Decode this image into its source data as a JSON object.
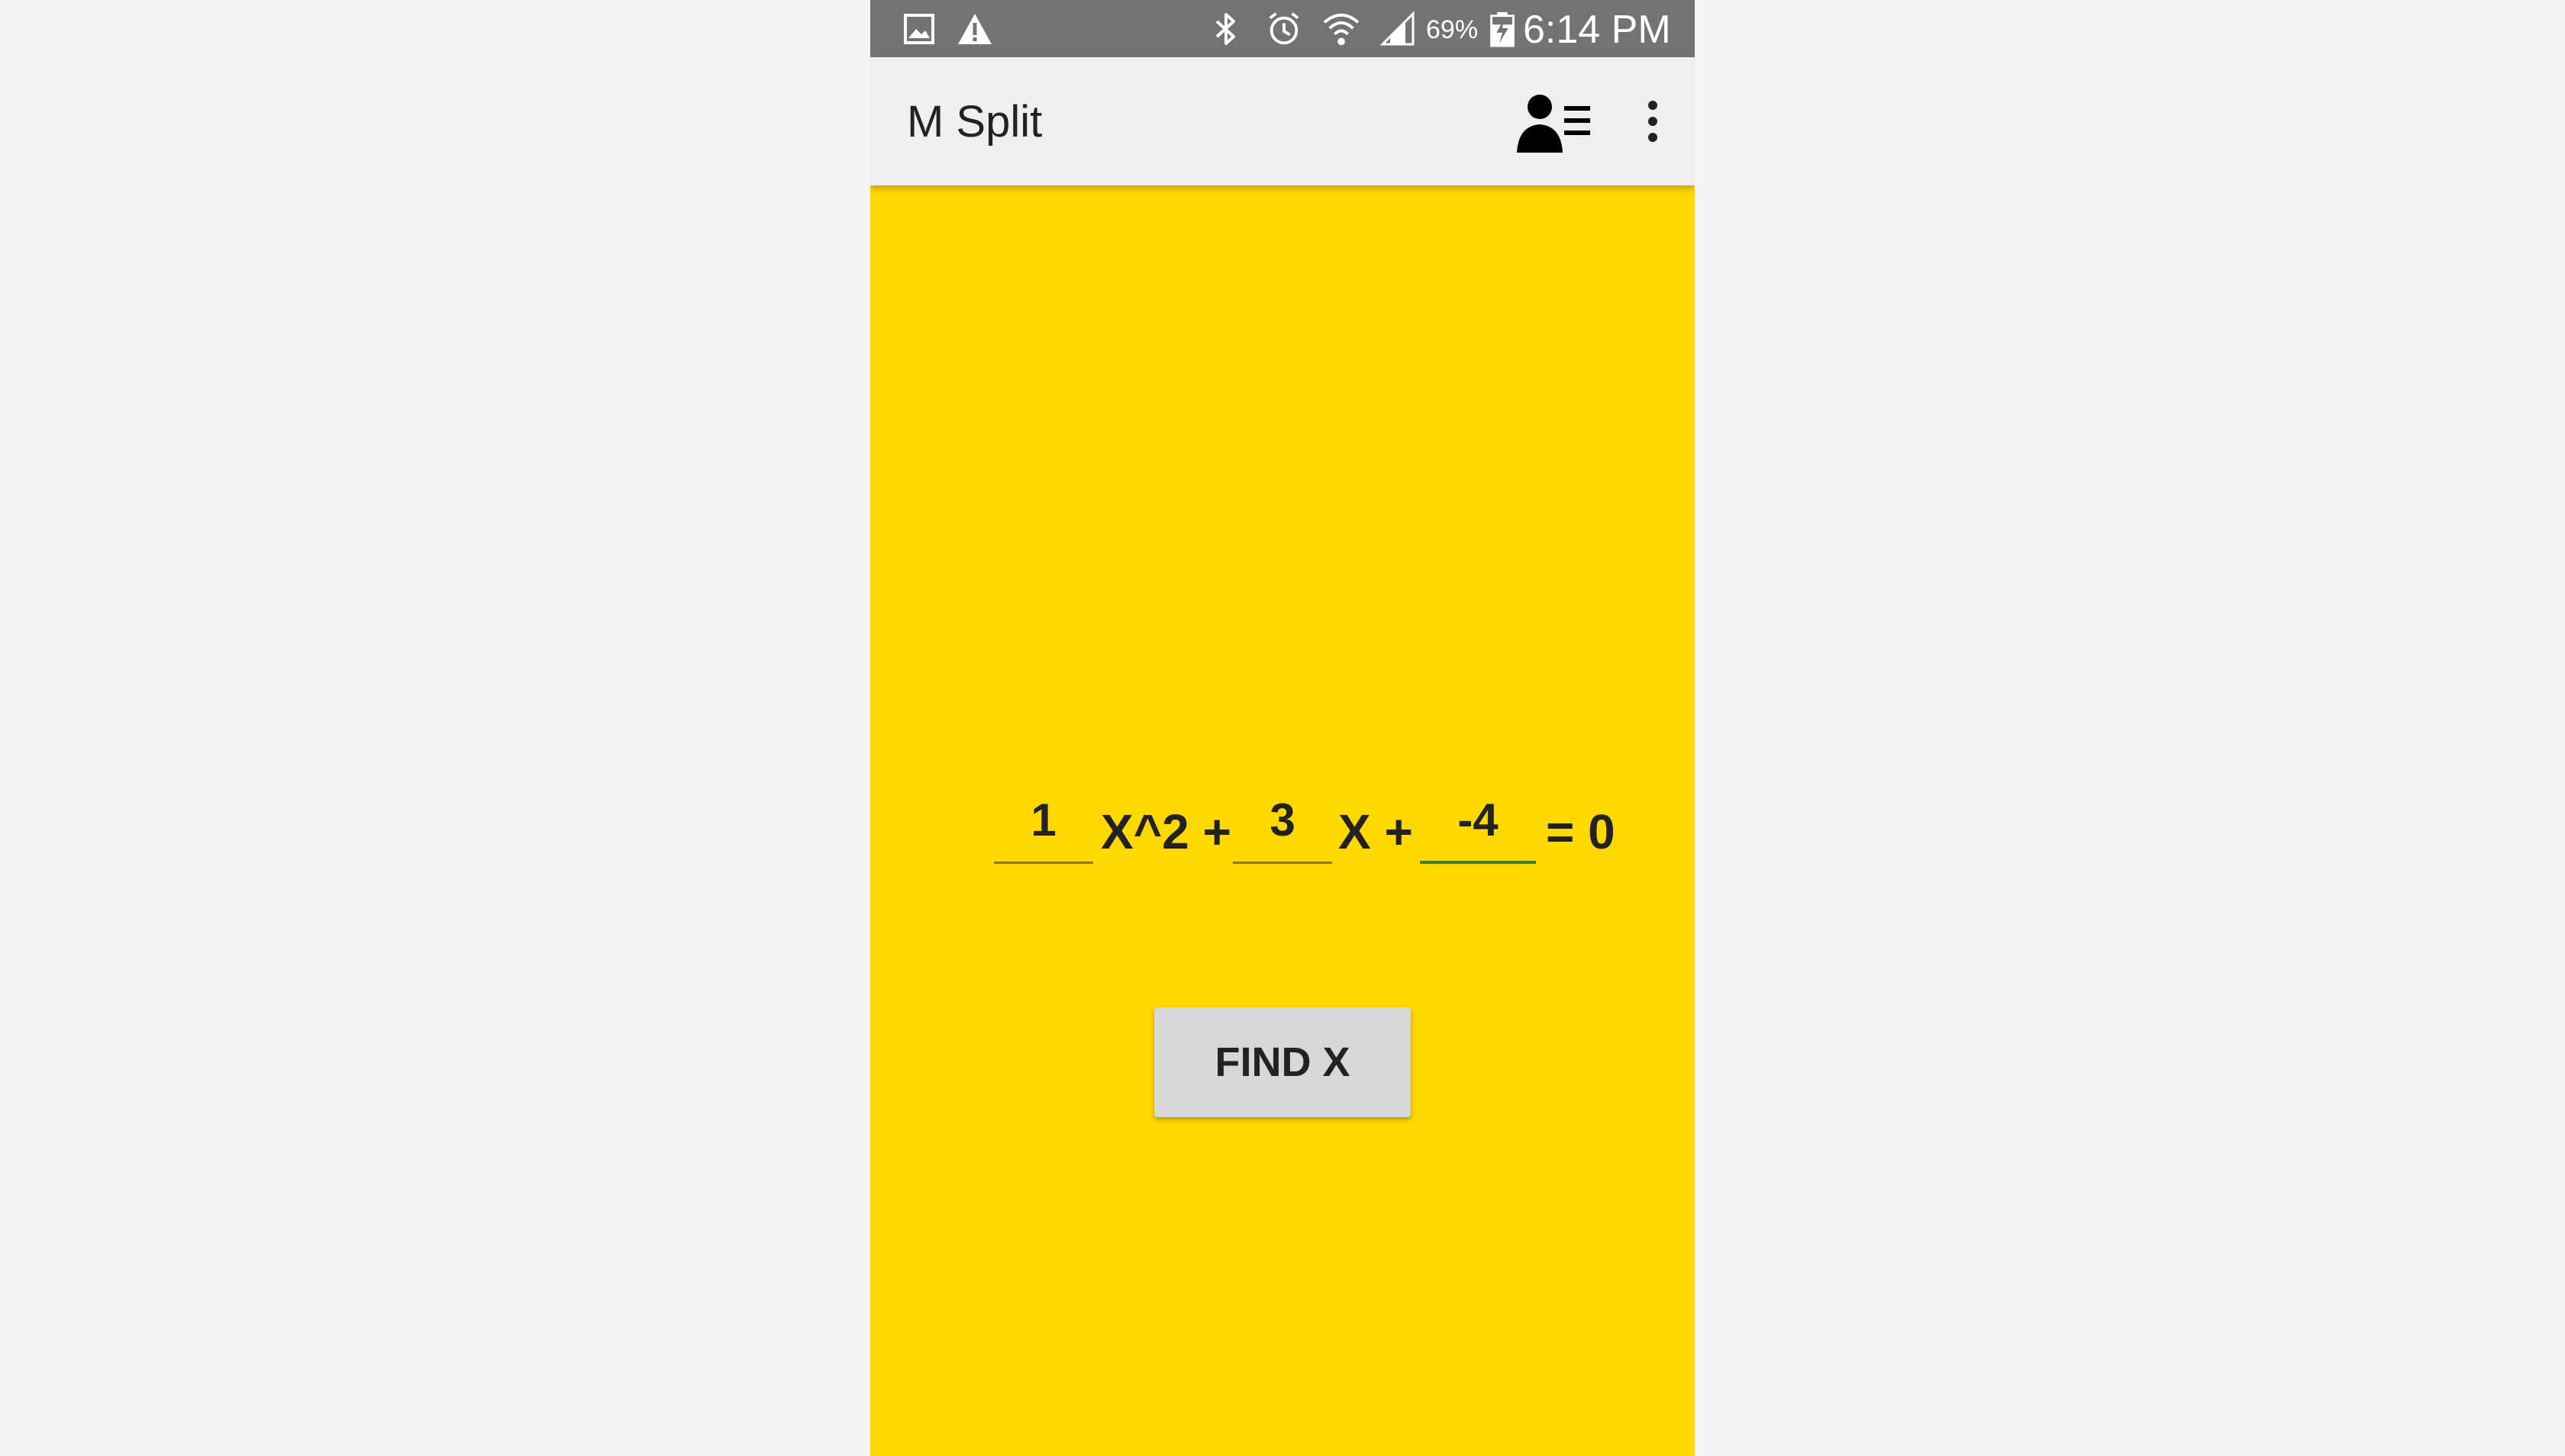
{
  "status_bar": {
    "icons": [
      "gallery-icon",
      "warning-icon",
      "bluetooth-icon",
      "alarm-icon",
      "wifi-icon",
      "signal-icon",
      "battery-charging-icon"
    ],
    "battery": "69%",
    "time": "6:14 PM"
  },
  "app_bar": {
    "title": "M Split",
    "actions": [
      "contacts-list-icon",
      "more-vert-icon"
    ]
  },
  "equation": {
    "a": "1",
    "x2_label": "X^2 +",
    "b": "3",
    "x_label": "X +",
    "c": "-4",
    "rhs_label": "= 0"
  },
  "find_button": {
    "label": "FIND X"
  },
  "colors": {
    "background": "#ffd800",
    "status_bar": "#737373",
    "app_bar": "#efefef",
    "button": "#d6d7d6",
    "focus_underline": "#2e7d5b"
  }
}
